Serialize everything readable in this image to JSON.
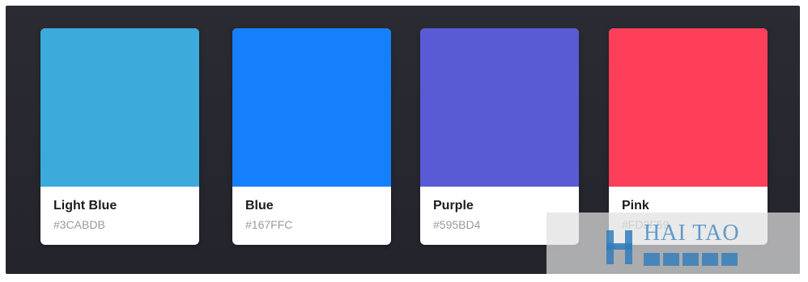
{
  "cards": [
    {
      "name": "Light Blue",
      "hex": "#3CABDB",
      "color": "#3CABDB"
    },
    {
      "name": "Blue",
      "hex": "#167FFC",
      "color": "#167FFC"
    },
    {
      "name": "Purple",
      "hex": "#595BD4",
      "color": "#595BD4"
    },
    {
      "name": "Pink",
      "hex": "#FD3F59",
      "color": "#FD3F59"
    }
  ],
  "colors": {
    "background": "#23242C",
    "card": "#FFFFFF",
    "watermark": "#4A8EC4"
  },
  "watermark": {
    "text": "HAI TAO",
    "logo_icon": "h-logo-icon"
  }
}
